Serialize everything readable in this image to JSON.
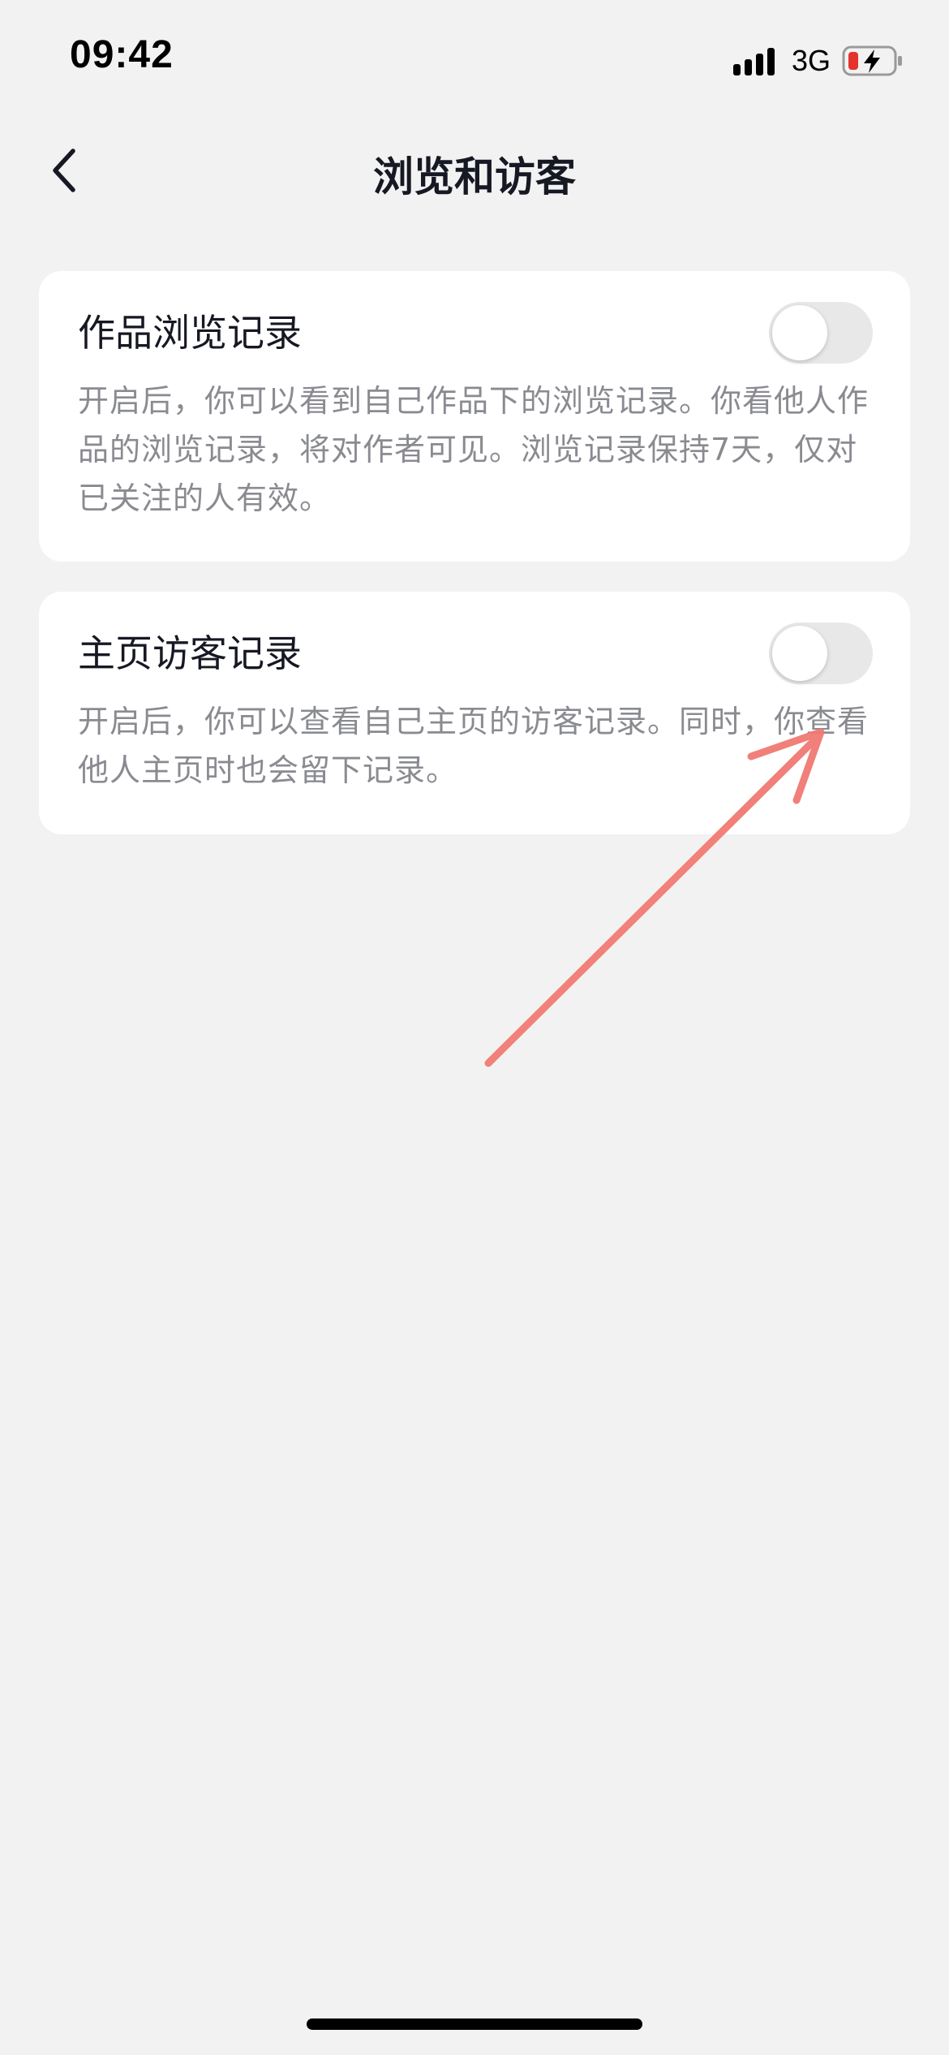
{
  "status_bar": {
    "time": "09:42",
    "network": "3G",
    "signal_icon": "signal-bars-icon",
    "battery_icon": "battery-charging-low-icon",
    "battery_color": "#e5322d"
  },
  "nav": {
    "title": "浏览和访客",
    "back_icon": "chevron-left-icon"
  },
  "settings": [
    {
      "title": "作品浏览记录",
      "description": "开启后，你可以看到自己作品下的浏览记录。你看他人作品的浏览记录，将对作者可见。浏览记录保持7天，仅对已关注的人有效。",
      "enabled": false
    },
    {
      "title": "主页访客记录",
      "description": "开启后，你可以查看自己主页的访客记录。同时，你查看他人主页时也会留下记录。",
      "enabled": false
    }
  ],
  "colors": {
    "background": "#f2f2f2",
    "card": "#ffffff",
    "toggle_off": "#e8e8e9",
    "annotation_arrow": "#f07a72"
  }
}
